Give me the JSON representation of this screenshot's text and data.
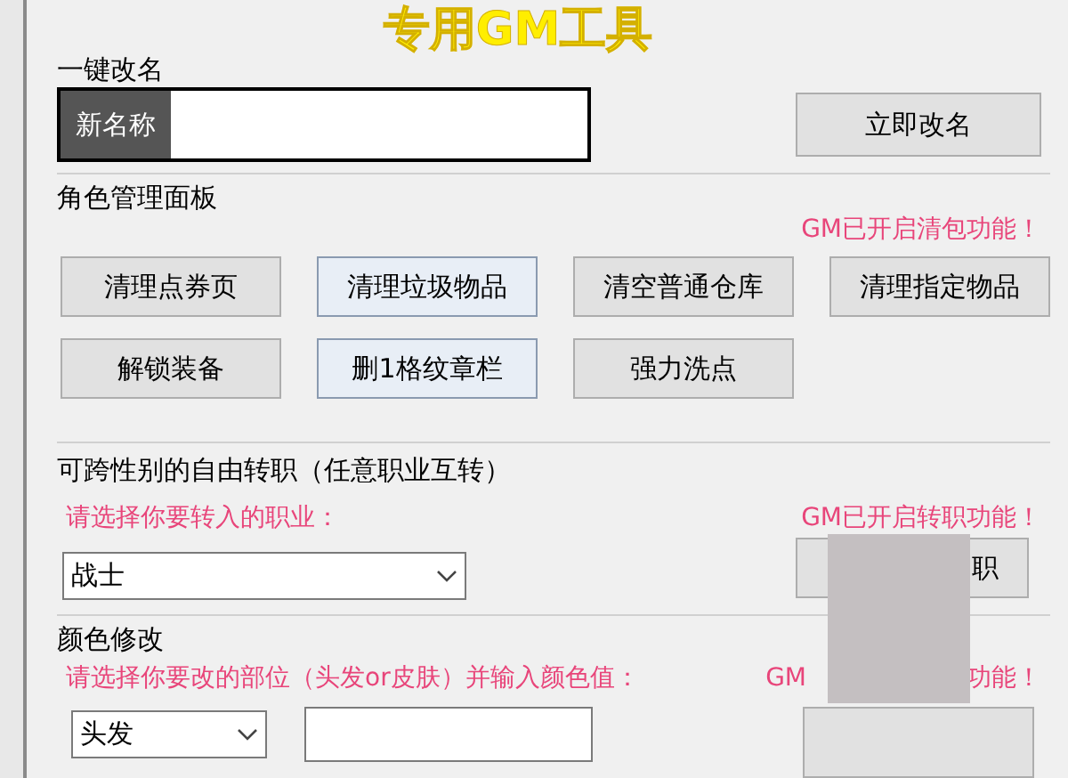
{
  "title": "专用GM工具",
  "rename": {
    "heading": "一键改名",
    "field_label": "新名称",
    "button": "立即改名"
  },
  "role_panel": {
    "heading": "角色管理面板",
    "notice": "GM已开启清包功能！",
    "buttons": [
      {
        "label": "清理点券页",
        "selected": false
      },
      {
        "label": "清理垃圾物品",
        "selected": true
      },
      {
        "label": "清空普通仓库",
        "selected": false
      },
      {
        "label": "清理指定物品",
        "selected": false
      },
      {
        "label": "解锁装备",
        "selected": false
      },
      {
        "label": "删1格纹章栏",
        "selected": true
      },
      {
        "label": "强力洗点",
        "selected": false
      }
    ]
  },
  "job_change": {
    "heading": "可跨性别的自由转职（任意职业互转）",
    "prompt": "请选择你要转入的职业：",
    "notice": "GM已开启转职功能！",
    "select_value": "战士",
    "button": "职"
  },
  "color_change": {
    "heading": "颜色修改",
    "prompt": "请选择你要改的部位（头发or皮肤）并输入颜色值：",
    "notice_start": "GM",
    "notice_end": "功能！",
    "select_value": "头发"
  }
}
